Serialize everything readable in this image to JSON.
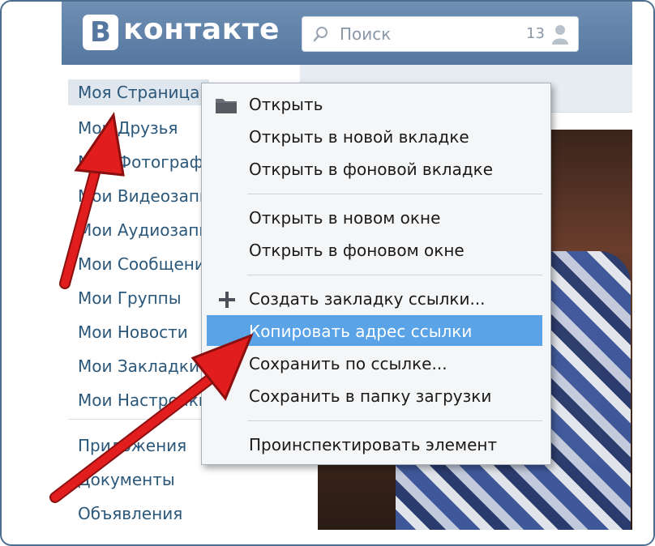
{
  "header": {
    "logo_letter": "B",
    "logo_text": "контакте",
    "search_placeholder": "Поиск",
    "search_count": "13"
  },
  "sidebar": {
    "items": [
      {
        "label": "Моя Страница",
        "active": true
      },
      {
        "label": "Мои Друзья"
      },
      {
        "label": "Мои Фотографии"
      },
      {
        "label": "Мои Видеозаписи"
      },
      {
        "label": "Мои Аудиозаписи"
      },
      {
        "label": "Мои Сообщения"
      },
      {
        "label": "Мои Группы"
      },
      {
        "label": "Мои Новости"
      },
      {
        "label": "Мои Закладки"
      },
      {
        "label": "Мои Настройки"
      }
    ],
    "extra": [
      {
        "label": "Приложения"
      },
      {
        "label": "Документы"
      },
      {
        "label": "Объявления"
      }
    ]
  },
  "context_menu": {
    "items": [
      {
        "label": "Открыть",
        "icon": "folder-icon"
      },
      {
        "label": "Открыть в новой вкладке"
      },
      {
        "label": "Открыть в фоновой вкладке"
      },
      {
        "label": "Открыть в новом окне"
      },
      {
        "label": "Открыть в фоновом окне"
      },
      {
        "label": "Создать закладку ссылки...",
        "icon": "plus-icon"
      },
      {
        "label": "Копировать адрес ссылки",
        "highlighted": true
      },
      {
        "label": "Сохранить по ссылке..."
      },
      {
        "label": "Сохранить в папку загрузки"
      },
      {
        "label": "Проинспектировать элемент"
      }
    ]
  },
  "colors": {
    "header": "#5577a0",
    "link": "#2b587a",
    "menu_highlight": "#5aa3e6",
    "arrow": "#e21d1d"
  }
}
